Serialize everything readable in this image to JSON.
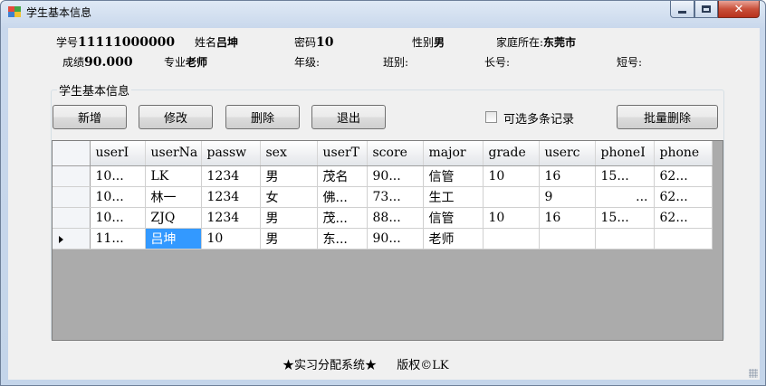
{
  "window": {
    "title": "学生基本信息"
  },
  "info": {
    "student_id_label": "学号",
    "student_id": "11111000000",
    "name_label": "姓名",
    "name": "吕坤",
    "password_label": "密码",
    "password": "10",
    "gender_label": "性别",
    "gender": "男",
    "address_label": "家庭所在:",
    "address": "东莞市",
    "score_label": "成绩",
    "score": "90.000",
    "major_label": "专业",
    "major": "老师",
    "grade_label": "年级:",
    "class_label": "班别:",
    "long_no_label": "长号:",
    "short_no_label": "短号:"
  },
  "group": {
    "title": "学生基本信息"
  },
  "toolbar": {
    "add_label": "新增",
    "edit_label": "修改",
    "delete_label": "删除",
    "exit_label": "退出",
    "multi_select_label": "可选多条记录",
    "batch_delete_label": "批量删除"
  },
  "grid": {
    "columns": [
      "userI",
      "userNa",
      "passw",
      "sex",
      "userT",
      "score",
      "major",
      "grade",
      "userc",
      "phoneI",
      "phone"
    ],
    "rows": [
      [
        "10...",
        "LK",
        "1234",
        "男",
        "茂名",
        "90...",
        "信管",
        "10",
        "16",
        "15...",
        "62..."
      ],
      [
        "10...",
        "林一",
        "1234",
        "女",
        "佛...",
        "73...",
        "生工",
        "",
        "9",
        "...",
        "62..."
      ],
      [
        "10...",
        "ZJQ",
        "1234",
        "男",
        "茂...",
        "88...",
        "信管",
        "10",
        "16",
        "15...",
        "62..."
      ],
      [
        "11...",
        "吕坤",
        "10",
        "男",
        "东...",
        "90...",
        "老师",
        "",
        "",
        "",
        ""
      ]
    ]
  },
  "footer": {
    "left": "★实习分配系统★",
    "right": "版权©LK"
  },
  "colors": {
    "selection": "#3399ff",
    "grid_background": "#ababab",
    "close_button": "#c9503a"
  }
}
